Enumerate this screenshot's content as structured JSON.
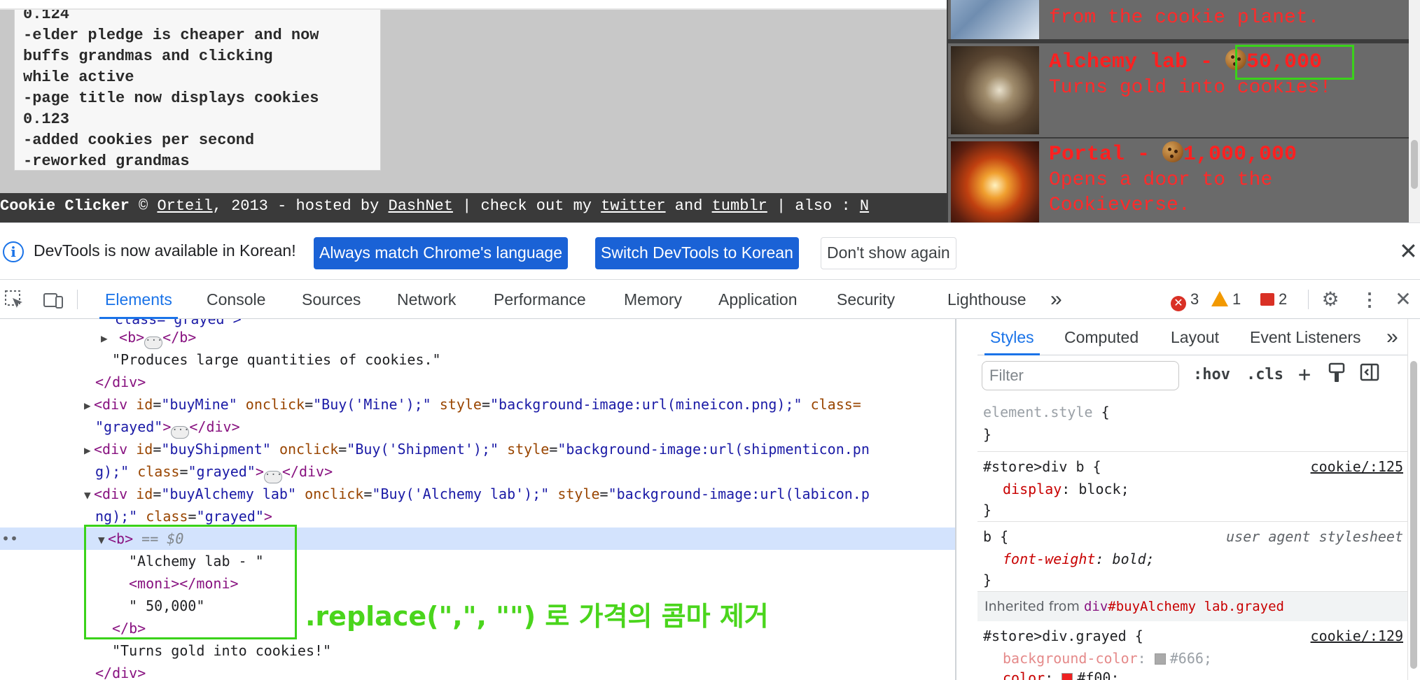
{
  "game": {
    "updates_lines": [
      "0.124",
      "-elder pledge is cheaper and now",
      "buffs grandmas and clicking",
      "while active",
      "-page title now displays cookies",
      "0.123",
      "-added cookies per second",
      "-reworked grandmas"
    ],
    "footer": {
      "prefix": "Cookie Clicker",
      "copy": " © ",
      "author": "Orteil",
      "mid": ", 2013 - hosted by ",
      "host": "DashNet",
      "mid2": " | check out my ",
      "twitter": "twitter",
      "and": " and ",
      "tumblr": "tumblr",
      "tail": " | also : ",
      "last": "N"
    },
    "store": [
      {
        "name": "",
        "price": "",
        "desc": "from the cookie planet."
      },
      {
        "name": "Alchemy lab - ",
        "price": "50,000",
        "desc": "Turns gold into cookies!"
      },
      {
        "name": "Portal - ",
        "price": "1,000,000",
        "desc": "Opens a door to the",
        "desc2": "Cookieverse."
      }
    ]
  },
  "infobar": {
    "message": "DevTools is now available in Korean!",
    "btn_match": "Always match Chrome's language",
    "btn_switch": "Switch DevTools to Korean",
    "btn_dont": "Don't show again"
  },
  "toolbar": {
    "tabs": [
      "Elements",
      "Console",
      "Sources",
      "Network",
      "Performance",
      "Memory",
      "Application",
      "Security",
      "Lighthouse"
    ],
    "more": "»",
    "errors": "3",
    "warnings": "1",
    "issues": "2"
  },
  "elements": {
    "r0": "class=\"grayed\">",
    "r1_tag": "<b>",
    "r1_end": "</b>",
    "r2": "\"Produces large quantities of cookies.\"",
    "r3": "</div>",
    "r4": {
      "open": "<div",
      "id_n": "id",
      "id_v": "\"buyMine\"",
      "oc_n": "onclick",
      "oc_v": "\"Buy('Mine');\"",
      "st_n": "style",
      "st_v": "\"background-image:url(mineicon.png);\"",
      "cl_n": "class="
    },
    "r5": {
      "cl_v": "\"grayed\"",
      "gt": ">",
      "end": "</div>"
    },
    "r6": {
      "open": "<div",
      "id_n": "id",
      "id_v": "\"buyShipment\"",
      "oc_n": "onclick",
      "oc_v": "\"Buy('Shipment');\"",
      "st_n": "style",
      "st_v": "\"background-image:url(shipmenticon.pn"
    },
    "r7": {
      "st_v2": "g);\"",
      "cl_n": "class",
      "cl_v": "\"grayed\"",
      "gt": ">",
      "end": "</div>"
    },
    "r8": {
      "open": "<div",
      "id_n": "id",
      "id_v": "\"buyAlchemy lab\"",
      "oc_n": "onclick",
      "oc_v": "\"Buy('Alchemy lab');\"",
      "st_n": "style",
      "st_v": "\"background-image:url(labicon.p"
    },
    "r9": {
      "st_v2": "ng);\"",
      "cl_n": "class",
      "cl_v": "\"grayed\"",
      "gt": ">"
    },
    "r10": {
      "tag": "<b>",
      "eq": " == $0"
    },
    "r11": "\"Alchemy lab - \"",
    "r12": "<moni></moni>",
    "r13": "\" 50,000\"",
    "r14": "</b>",
    "r15": "\"Turns gold into cookies!\"",
    "r16": "</div>"
  },
  "annotation": ".replace(\",\", \"\") 로 가격의 콤마 제거",
  "styles": {
    "tabs": [
      "Styles",
      "Computed",
      "Layout",
      "Event Listeners"
    ],
    "more": "»",
    "filter_placeholder": "Filter",
    "hov": ":hov",
    "cls": ".cls",
    "rule1": {
      "sel": "element.style",
      "open": " {",
      "close": "}"
    },
    "rule2": {
      "sel": "#store>div b",
      "open": " {",
      "src": "cookie/:125",
      "prop": "display",
      "val": "block;",
      "close": "}"
    },
    "rule3": {
      "sel": "b",
      "open": " {",
      "src": "user agent stylesheet",
      "prop": "font-weight",
      "val": "bold;",
      "close": "}"
    },
    "inherited": {
      "label": "Inherited from ",
      "tag": "div",
      "id": "#buyAlchemy",
      "cls": " lab.grayed"
    },
    "rule4": {
      "sel": "#store>div.grayed",
      "open": " {",
      "src": "cookie/:129",
      "p1": "background-color",
      "v1": "#666;",
      "c1": "#666666",
      "p2": "color",
      "v2": "#f00;",
      "c2": "#ff0000"
    }
  }
}
